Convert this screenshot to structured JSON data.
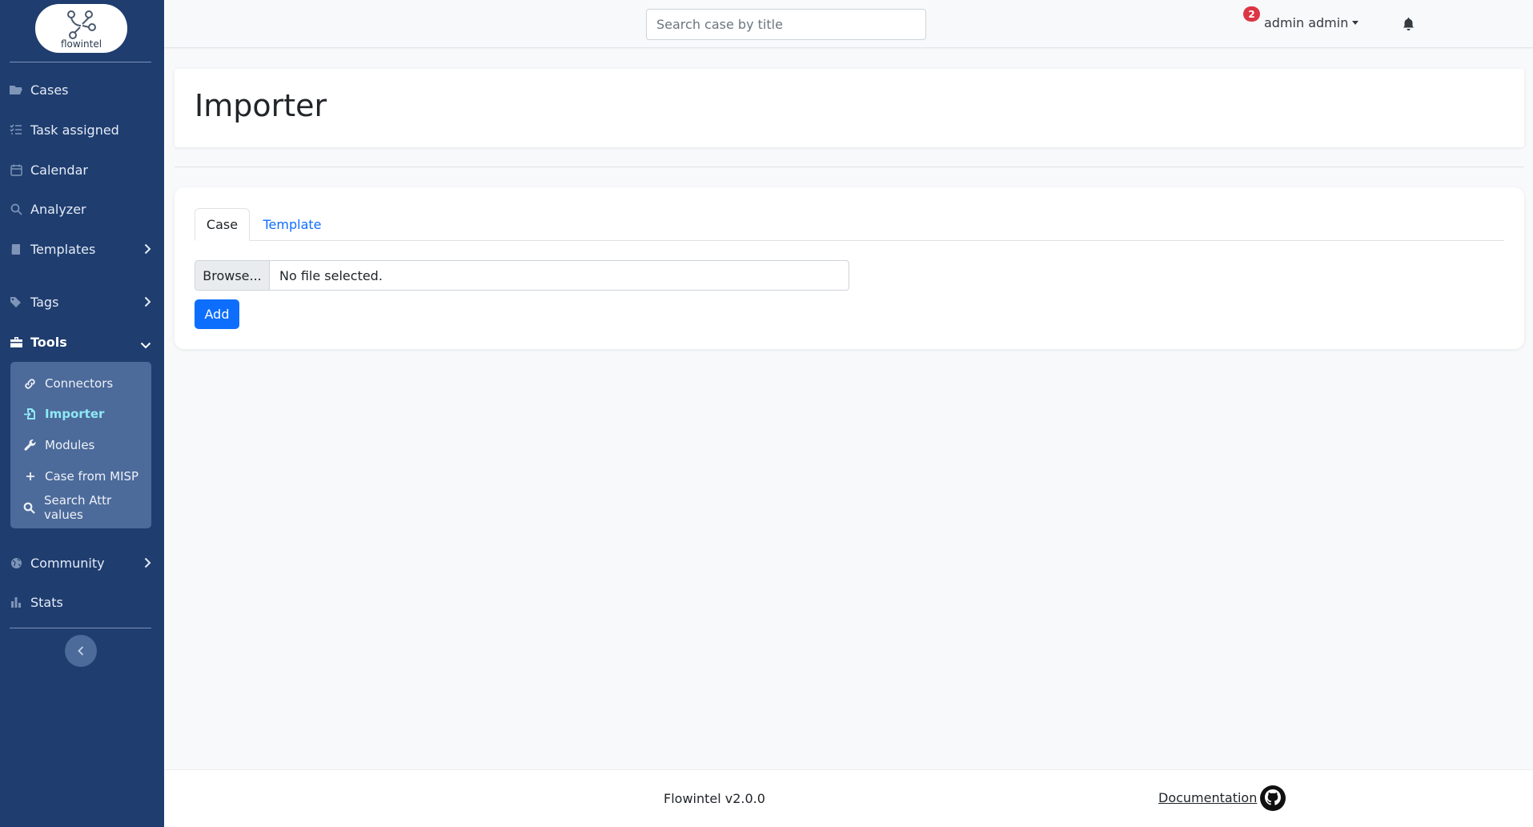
{
  "brand": {
    "logo_text": "flowintel"
  },
  "sidebar": {
    "items": [
      {
        "label": "Cases",
        "icon": "folder-open-icon"
      },
      {
        "label": "Task assigned",
        "icon": "list-check-icon"
      },
      {
        "label": "Calendar",
        "icon": "calendar-icon"
      },
      {
        "label": "Analyzer",
        "icon": "search-icon"
      },
      {
        "label": "Templates",
        "icon": "book-icon"
      },
      {
        "label": "Tags",
        "icon": "tags-icon"
      },
      {
        "label": "Tools",
        "icon": "toolbox-icon"
      },
      {
        "label": "Community",
        "icon": "globe-icon"
      },
      {
        "label": "Stats",
        "icon": "bar-chart-icon"
      }
    ],
    "tools_sub": [
      {
        "label": "Connectors",
        "icon": "link-icon"
      },
      {
        "label": "Importer",
        "icon": "file-import-icon",
        "active": true
      },
      {
        "label": "Modules",
        "icon": "wrench-icon"
      },
      {
        "label": "Case from MISP",
        "icon": "plus-icon"
      },
      {
        "label": "Search Attr values",
        "icon": "search-icon"
      }
    ]
  },
  "header": {
    "search_placeholder": "Search case by title",
    "notification_count": "2",
    "user_name": "admin admin"
  },
  "page": {
    "title": "Importer",
    "tabs": [
      "Case",
      "Template"
    ],
    "active_tab": "Case",
    "file_button": "Browse...",
    "file_status": "No file selected.",
    "add_label": "Add"
  },
  "footer": {
    "version": "Flowintel v2.0.0",
    "doc_link": "Documentation"
  },
  "colors": {
    "sidebar_bg": "#1f3d6f",
    "submenu_bg": "#4c6a9a",
    "active_item": "#8fe8f5",
    "primary": "#0d6efd",
    "badge": "#dc3545"
  }
}
